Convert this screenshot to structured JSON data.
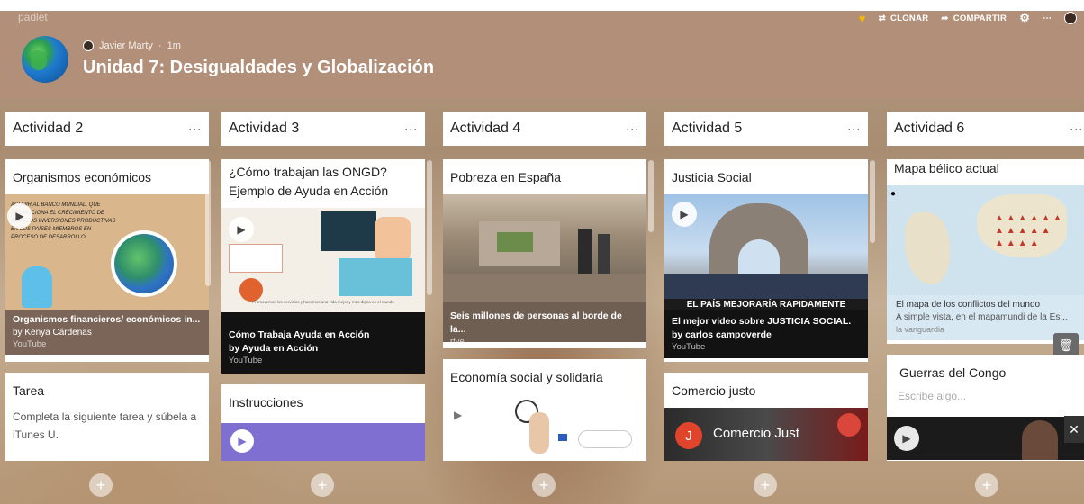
{
  "app": {
    "brand": "padlet"
  },
  "toolbar": {
    "clone_label": "CLONAR",
    "share_label": "COMPARTIR"
  },
  "header": {
    "author": "Javier Marty",
    "time": "1m",
    "title": "Unidad 7: Desigualdades y Globalización"
  },
  "columns": [
    {
      "title": "Actividad 2",
      "cards": [
        {
          "title": "Organismos económicos",
          "caption_title": "Organismos financieros/ económicos in...",
          "caption_by": "by Kenya Cárdenas",
          "caption_src": "YouTube",
          "thumb_text": "ACUDIR AL BANCO MUNDIAL, QUE PROMOCIONA EL CRECIMIENTO DE EMPLEOS INVERSIONES PRODUCTIVAS EN LOS PAÍSES MIEMBROS EN PROCESO DE DESARROLLO"
        },
        {
          "title": "Tarea",
          "body": "Completa la siguiente tarea y súbela a iTunes U."
        }
      ]
    },
    {
      "title": "Actividad 3",
      "cards": [
        {
          "title": "¿Cómo trabajan las ONGD? Ejemplo de Ayuda en Acción",
          "caption_title": "Cómo Trabaja Ayuda en Acción",
          "caption_by": "by Ayuda en Acción",
          "caption_src": "YouTube",
          "thumb_text": "Promovemos los servicios y hacemos una vida mejor y más digna en el mundo"
        },
        {
          "title": "Instrucciones"
        }
      ]
    },
    {
      "title": "Actividad 4",
      "cards": [
        {
          "title": "Pobreza en España",
          "caption_title": "Seis millones de personas al borde de la...",
          "caption_src": "rtve"
        },
        {
          "title": "Economía social y solidaria"
        }
      ]
    },
    {
      "title": "Actividad 5",
      "cards": [
        {
          "title": "Justicia Social",
          "caption_title": "El mejor video sobre JUSTICIA SOCIAL.",
          "caption_by": "by carlos campoverde",
          "caption_src": "YouTube",
          "thumb_text": "EL PAÍS MEJORARÍA RAPIDAMENTE"
        },
        {
          "title": "Comercio justo",
          "video_title": "Comercio Just",
          "channel_initial": "J"
        }
      ]
    },
    {
      "title": "Actividad 6",
      "cards": [
        {
          "title": "Mapa bélico actual",
          "caption_title": "El mapa de los conflictos del mundo",
          "caption_desc": "A simple vista, en el mapamundi de la Es...",
          "caption_src": "la vanguardia"
        },
        {
          "title": "Guerras del Congo",
          "placeholder": "Escribe algo..."
        }
      ]
    }
  ],
  "colors": {
    "header_bg": "#b28f78",
    "accent": "#f5b800",
    "purple": "#7e6fd0"
  }
}
